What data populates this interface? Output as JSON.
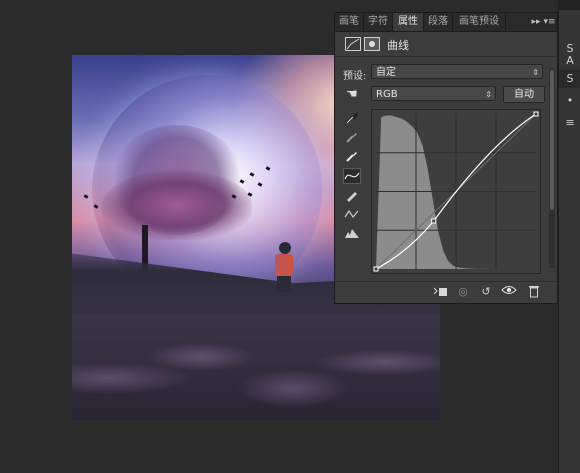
{
  "tabs": [
    {
      "label": "画笔",
      "active": false
    },
    {
      "label": "字符",
      "active": false
    },
    {
      "label": "属性",
      "active": true
    },
    {
      "label": "段落",
      "active": false
    },
    {
      "label": "画笔预设",
      "active": false
    }
  ],
  "panel_controls": {
    "collapse": "▸▸",
    "menu": "▾≡"
  },
  "properties": {
    "title": "曲线",
    "preset_label": "预设:",
    "preset_value": "自定",
    "channel_value": "RGB",
    "auto_label": "自动"
  },
  "curve": {
    "points_input_output": [
      [
        0,
        0
      ],
      [
        92,
        79
      ],
      [
        255,
        255
      ]
    ],
    "histogram_color": "#8c8c8c",
    "line_color": "#ffffff"
  },
  "right_column": {
    "labels": [
      "S",
      "A",
      "S",
      "•",
      "≡"
    ]
  },
  "icons": {
    "hand": "hand-icon",
    "tools": [
      "eyedropper-black-icon",
      "eyedropper-gray-icon",
      "eyedropper-white-icon",
      "curve-point-icon",
      "pencil-icon",
      "smooth-icon",
      "clipping-warning-icon"
    ],
    "footer": [
      "clip-to-layer-icon",
      "view-previous-icon",
      "reset-icon",
      "visibility-eye-icon",
      "trash-icon"
    ]
  }
}
